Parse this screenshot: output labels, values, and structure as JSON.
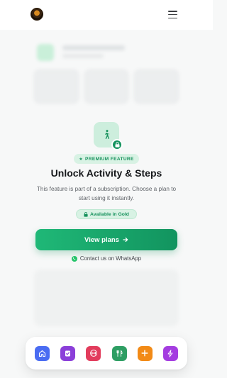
{
  "header": {
    "avatar_icon": "user-avatar",
    "menu_icon": "hamburger-menu-icon"
  },
  "locked_feature": {
    "icon": "walking-person-icon",
    "badge_icon": "lock-icon",
    "premium_label": "PREMIUM FEATURE",
    "title": "Unlock Activity & Steps",
    "description": "This feature is part of a subscription. Choose a plan to start using it instantly.",
    "availability_label": "Available in Gold",
    "cta_label": "View plans",
    "contact_label": "Contact us on WhatsApp"
  },
  "dock": {
    "items": [
      {
        "name": "home",
        "icon": "home-icon",
        "color": "#4a6cf2"
      },
      {
        "name": "checklist",
        "icon": "checklist-icon",
        "color": "#8b3fd9"
      },
      {
        "name": "fitness",
        "icon": "dumbbell-icon",
        "color": "#e23c5c"
      },
      {
        "name": "nutrition",
        "icon": "fork-knife-icon",
        "color": "#2e9e63"
      },
      {
        "name": "add",
        "icon": "plus-icon",
        "color": "#f28a16"
      },
      {
        "name": "energy",
        "icon": "lightning-icon",
        "color": "#a43de0"
      }
    ]
  },
  "colors": {
    "accent": "#15935e",
    "accent_light": "#d8f2e4",
    "background": "#f7f8f8"
  }
}
